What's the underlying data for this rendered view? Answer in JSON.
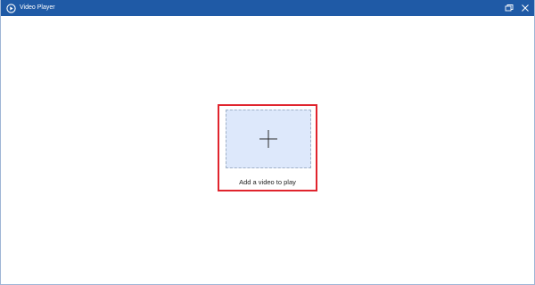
{
  "window": {
    "title": "Video Player",
    "title_bar_color": "#1f5aa6",
    "icons": {
      "app": "play-circle-icon",
      "restore": "restore-window-icon",
      "close": "close-icon"
    }
  },
  "main": {
    "add_video_label": "Add a video to play",
    "dropzone_icon": "plus-icon",
    "highlight_color": "#e0242d",
    "dropzone_color": "#dde8fb"
  }
}
